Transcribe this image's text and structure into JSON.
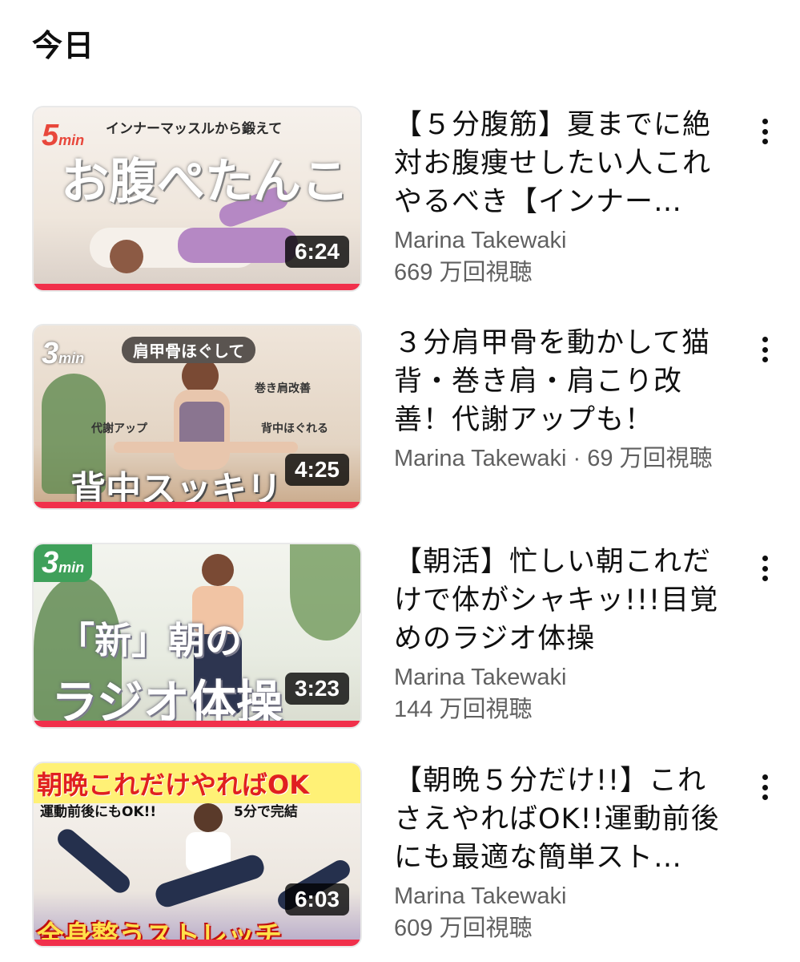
{
  "section": {
    "title": "今日"
  },
  "videos": [
    {
      "title": "【５分腹筋】夏までに絶対お腹痩せしたい人これやるべき【インナー…",
      "channel": "Marina Takewaki",
      "views": "669 万回視聴",
      "duration": "6:24",
      "thumb": {
        "tag_num": "5",
        "tag_unit": "min",
        "caption": "インナーマッスルから鍛えて",
        "headline": "お腹ぺたんこ"
      },
      "colors": {
        "bg": "#f3ece6",
        "tag": "#e8473b",
        "headline": "#ffffff"
      }
    },
    {
      "title": "３分肩甲骨を動かして猫背・巻き肩・肩こり改善！代謝アップも！",
      "channel": "Marina Takewaki",
      "views": "69 万回視聴",
      "channel_views_inline": "Marina Takewaki · 69 万回視聴",
      "duration": "4:25",
      "thumb": {
        "tag_num": "3",
        "tag_unit": "min",
        "caption": "肩甲骨ほぐして",
        "label1": "巻き肩改善",
        "label2": "代謝アップ",
        "label3": "背中ほぐれる",
        "headline": "背中スッキリ"
      },
      "colors": {
        "bg": "#e9ddd1",
        "tag": "#ffffff",
        "headline": "#ffffff"
      }
    },
    {
      "title": "【朝活】忙しい朝これだけで体がシャキッ!!!目覚めのラジオ体操",
      "channel": "Marina Takewaki",
      "views": "144 万回視聴",
      "duration": "3:23",
      "thumb": {
        "tag_num": "3",
        "tag_unit": "min",
        "caption": "「新」朝の",
        "headline": "ラジオ体操"
      },
      "colors": {
        "bg": "#eef1ea",
        "tag": "#ffffff",
        "headline": "#ffffff"
      }
    },
    {
      "title": "【朝晩５分だけ!!】これさえやればOK!!運動前後にも最適な簡単スト…",
      "channel": "Marina Takewaki",
      "views": "609 万回視聴",
      "duration": "6:03",
      "thumb": {
        "banner": "朝晩これだけやればOK",
        "sub1": "運動前後にもOK!!",
        "sub2": "5分で完結",
        "headline": "全身整うストレッチ"
      },
      "colors": {
        "bg": "#f2eeea",
        "banner": "#e02020",
        "headline": "#ffe14a"
      }
    }
  ]
}
